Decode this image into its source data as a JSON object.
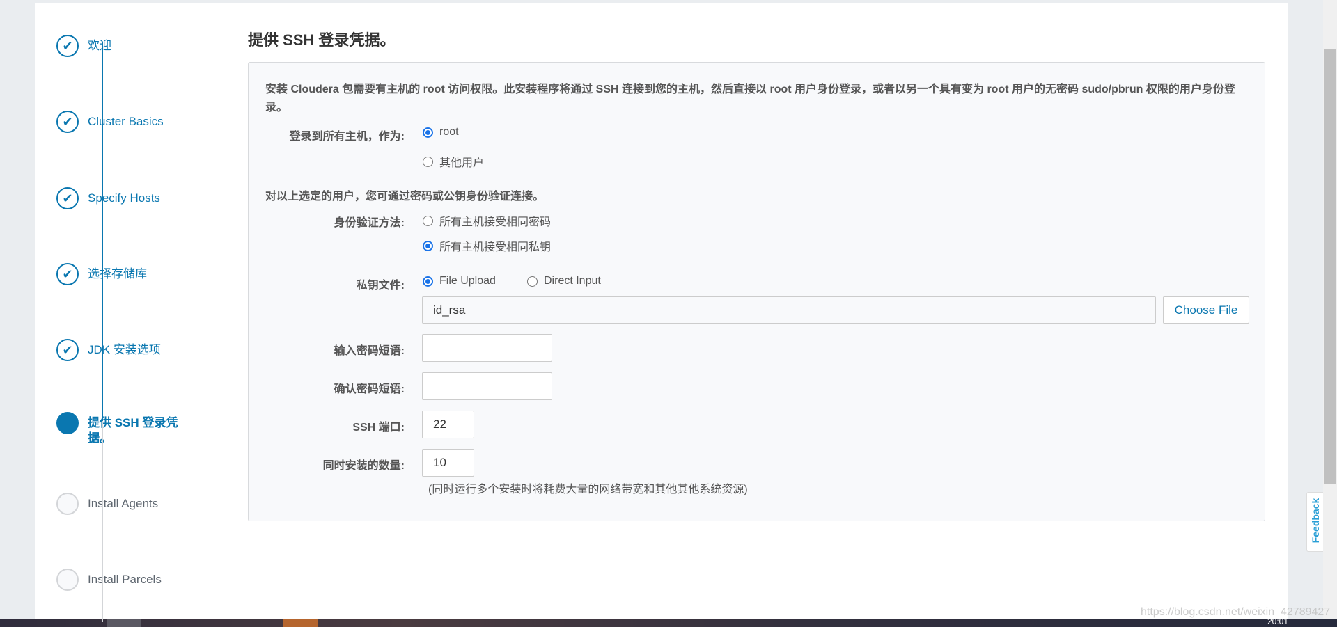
{
  "sidebar": {
    "steps": [
      {
        "label": "欢迎",
        "state": "done"
      },
      {
        "label": "Cluster Basics",
        "state": "done"
      },
      {
        "label": "Specify Hosts",
        "state": "done"
      },
      {
        "label": "选择存储库",
        "state": "done"
      },
      {
        "label": "JDK 安装选项",
        "state": "done"
      },
      {
        "label": "提供 SSH 登录凭据。",
        "state": "active"
      },
      {
        "label": "Install Agents",
        "state": "todo"
      },
      {
        "label": "Install Parcels",
        "state": "todo"
      }
    ]
  },
  "main": {
    "title": "提供 SSH 登录凭据。",
    "description": "安装 Cloudera 包需要有主机的 root 访问权限。此安装程序将通过 SSH 连接到您的主机，然后直接以 root 用户身份登录，或者以另一个具有变为 root 用户的无密码 sudo/pbrun 权限的用户身份登录。",
    "login_label": "登录到所有主机，作为:",
    "login_options": [
      "root",
      "其他用户"
    ],
    "login_selected": "root",
    "auth_note": "对以上选定的用户，您可通过密码或公钥身份验证连接。",
    "auth_label": "身份验证方法:",
    "auth_options": [
      "所有主机接受相同密码",
      "所有主机接受相同私钥"
    ],
    "auth_selected": "所有主机接受相同私钥",
    "key_label": "私钥文件:",
    "key_options": [
      "File Upload",
      "Direct Input"
    ],
    "key_selected": "File Upload",
    "key_file_value": "id_rsa",
    "choose_file_label": "Choose File",
    "passphrase_label": "输入密码短语:",
    "passphrase_value": "",
    "confirm_label": "确认密码短语:",
    "confirm_value": "",
    "port_label": "SSH 端口:",
    "port_value": "22",
    "parallel_label": "同时安装的数量:",
    "parallel_value": "10",
    "parallel_note": "(同时运行多个安装时将耗费大量的网络带宽和其他其他系统资源)"
  },
  "feedback_label": "Feedback",
  "watermark": "https://blog.csdn.net/weixin_42789427",
  "clock": "20:01",
  "colors": {
    "accent": "#0a77b0",
    "radio": "#1a73e8",
    "panel": "#f8f9fb"
  }
}
